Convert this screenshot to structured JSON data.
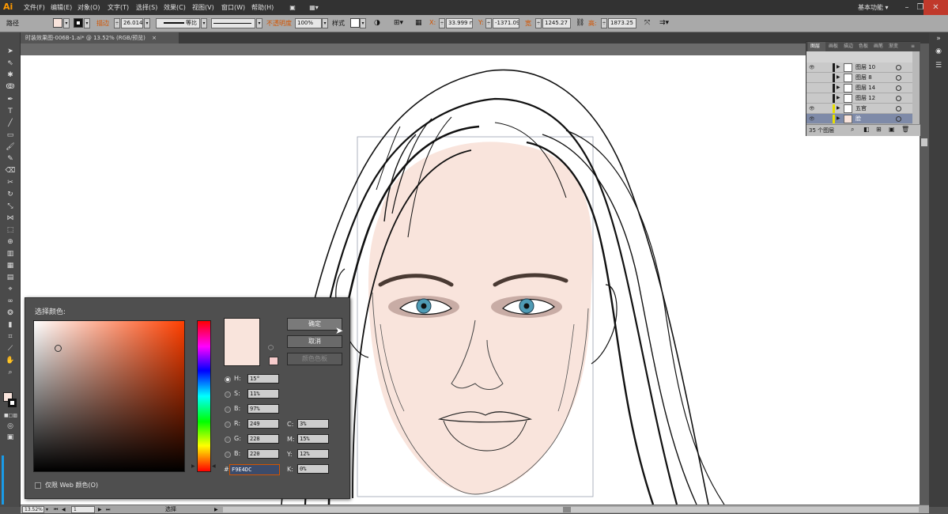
{
  "app": {
    "logo": "Ai",
    "workspace": "基本功能",
    "workspace_arrow": "▾"
  },
  "menus": [
    "文件(F)",
    "编辑(E)",
    "对象(O)",
    "文字(T)",
    "选择(S)",
    "效果(C)",
    "视图(V)",
    "窗口(W)",
    "帮助(H)"
  ],
  "control_bar": {
    "object_type": "路径",
    "stroke_label": "描边",
    "stroke_value": "26.014",
    "stroke_profile": "等比",
    "opacity_label": "不透明度",
    "opacity_value": "100%",
    "style_label": "样式",
    "x_label": "X:",
    "x_value": "33.999 mm",
    "y_label": "Y:",
    "y_value": "-1371.09",
    "w_label": "宽",
    "w_value": "1245.27",
    "h_label": "高:",
    "h_value": "1873.25",
    "fill_color": "#F9E4DC"
  },
  "document": {
    "tab_title": "时装效果图-006B-1.ai* @ 13.52% (RGB/预览)",
    "close": "×"
  },
  "layers_panel": {
    "tabs": [
      "图层",
      "画板",
      "描边",
      "色板",
      "画笔",
      "渐变"
    ],
    "rows": [
      {
        "name": "图层 10",
        "visible": true,
        "color": "#1a1a1a"
      },
      {
        "name": "图层 8",
        "visible": false,
        "color": "#1a1a1a"
      },
      {
        "name": "图层 14",
        "visible": false,
        "color": "#1a1a1a"
      },
      {
        "name": "图层 12",
        "visible": false,
        "color": "#1a1a1a"
      },
      {
        "name": "五官",
        "visible": true,
        "color": "#e8e000"
      },
      {
        "name": "脸",
        "visible": true,
        "color": "#e8e000",
        "selected": true
      }
    ],
    "count_label": "35 个图层"
  },
  "color_picker": {
    "title": "选择颜色:",
    "ok_label": "确定",
    "cancel_label": "取消",
    "swatches_label": "颜色色板",
    "hsb": [
      {
        "label": "H:",
        "value": "15°",
        "selected": true
      },
      {
        "label": "S:",
        "value": "11%",
        "selected": false
      },
      {
        "label": "B:",
        "value": "97%",
        "selected": false
      }
    ],
    "rgb": [
      {
        "label": "R:",
        "value": "249"
      },
      {
        "label": "G:",
        "value": "228"
      },
      {
        "label": "B:",
        "value": "220"
      }
    ],
    "cmyk": [
      {
        "label": "C:",
        "value": "3%"
      },
      {
        "label": "M:",
        "value": "15%"
      },
      {
        "label": "Y:",
        "value": "12%"
      },
      {
        "label": "K:",
        "value": "0%"
      }
    ],
    "hex_label": "#",
    "hex_value": "F9E4DC",
    "web_only_label": "仅限 Web 颜色(O)",
    "new_color": "#F9E4DC",
    "web_safe_color": "#F7CCCC"
  },
  "status_bar": {
    "zoom": "13.52%",
    "artboard": "1",
    "tool": "选择"
  }
}
